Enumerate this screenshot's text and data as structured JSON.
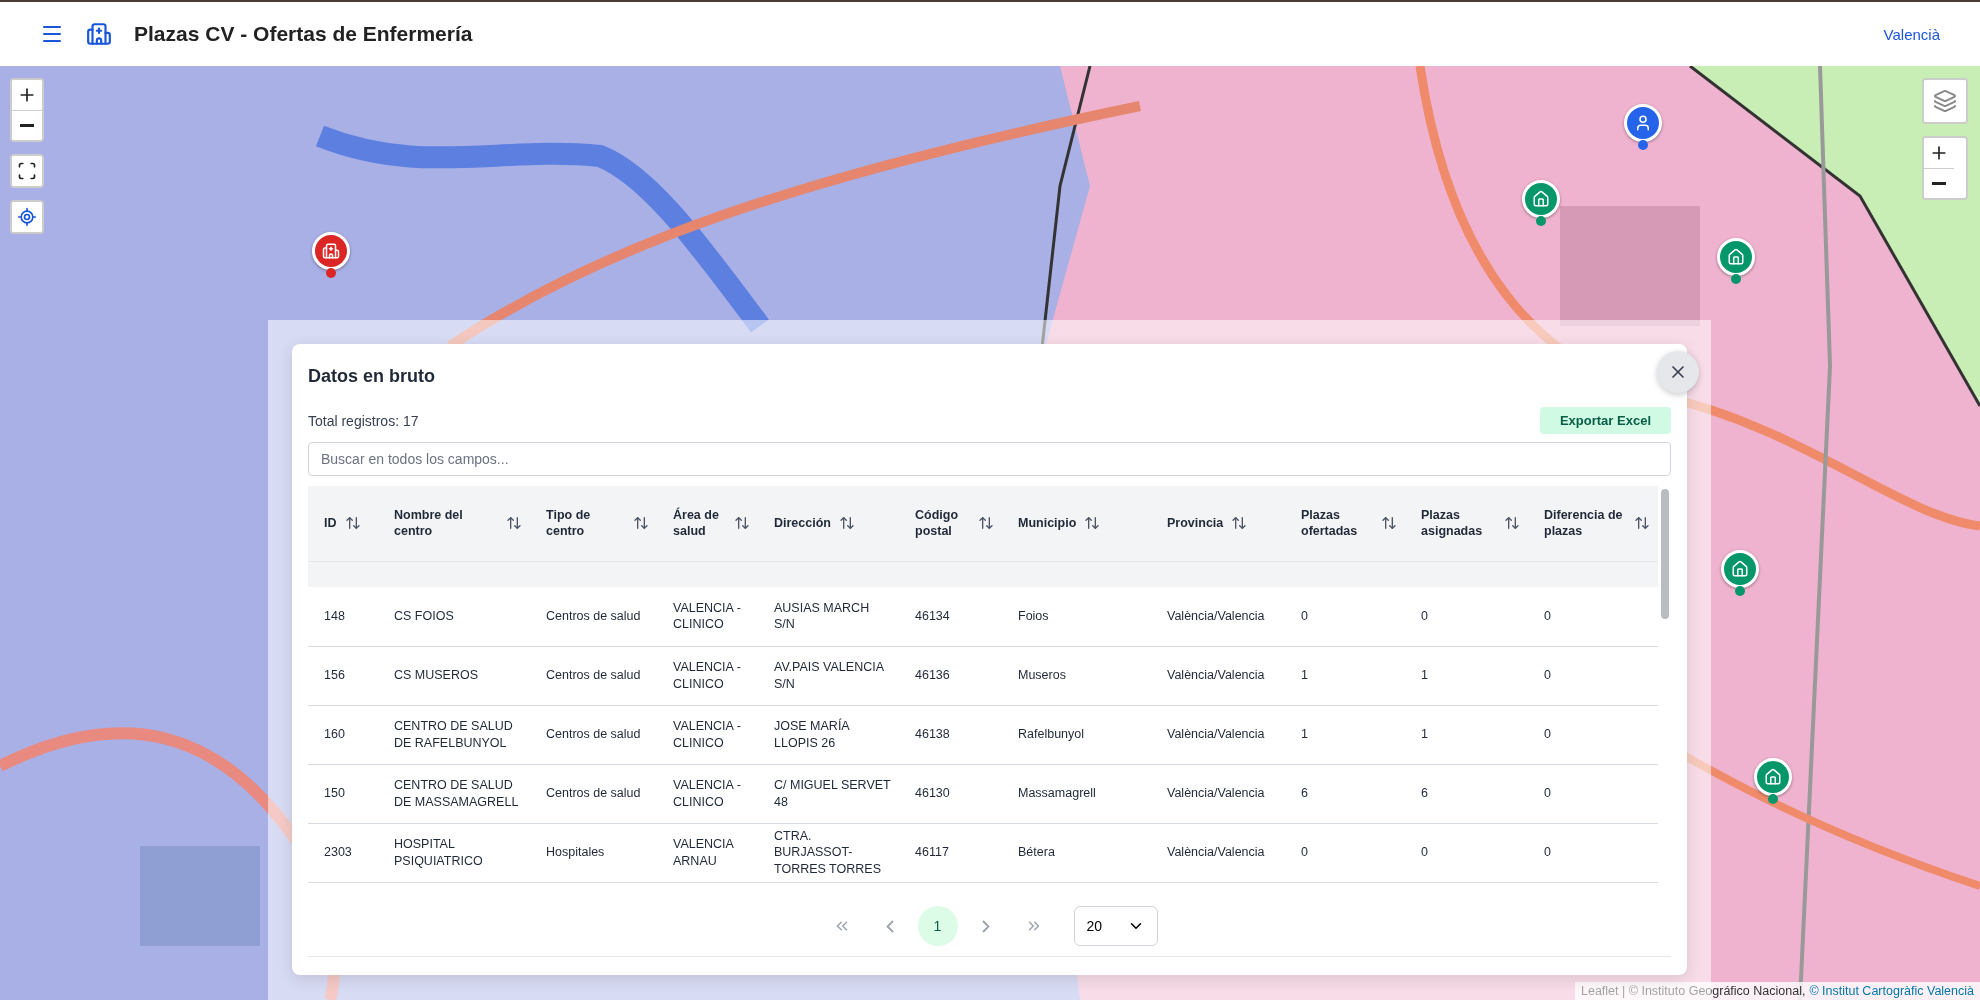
{
  "header": {
    "title": "Plazas CV - Ofertas de Enfermería",
    "language": "Valencià"
  },
  "map": {
    "markers": [
      {
        "kind": "hospital"
      },
      {
        "kind": "person"
      },
      {
        "kind": "health_center"
      },
      {
        "kind": "health_center"
      },
      {
        "kind": "health_center"
      },
      {
        "kind": "health_center"
      }
    ],
    "attribution": {
      "text": "Leaflet | © Instituto Geográfico Nacional,",
      "link": "© Institut Cartogràfic Valencià"
    }
  },
  "modal": {
    "title": "Datos en bruto",
    "total": "Total registros: 17",
    "export_button": "Exportar Excel",
    "search": {
      "placeholder": "Buscar en todos los campos..."
    },
    "columns": [
      "ID",
      "Nombre del centro",
      "Tipo de centro",
      "Área de salud",
      "Dirección",
      "Código postal",
      "Municipio",
      "Provincia",
      "Plazas ofertadas",
      "Plazas asignadas",
      "Diferencia de plazas"
    ],
    "rows": [
      [
        "148",
        "CS FOIOS",
        "Centros de salud",
        "VALENCIA - CLINICO",
        "AUSIAS MARCH S/N",
        "46134",
        "Foios",
        "València/Valencia",
        "0",
        "0",
        "0"
      ],
      [
        "156",
        "CS MUSEROS",
        "Centros de salud",
        "VALENCIA - CLINICO",
        "AV.PAIS VALENCIA S/N",
        "46136",
        "Museros",
        "València/Valencia",
        "1",
        "1",
        "0"
      ],
      [
        "160",
        "CENTRO DE SALUD DE RAFELBUNYOL",
        "Centros de salud",
        "VALENCIA - CLINICO",
        "JOSE MARÍA LLOPIS 26",
        "46138",
        "Rafelbunyol",
        "València/Valencia",
        "1",
        "1",
        "0"
      ],
      [
        "150",
        "CENTRO DE SALUD DE MASSAMAGRELL",
        "Centros de salud",
        "VALENCIA - CLINICO",
        "C/ MIGUEL SERVET 48",
        "46130",
        "Massamagrell",
        "València/Valencia",
        "6",
        "6",
        "0"
      ],
      [
        "2303",
        "HOSPITAL PSIQUIATRICO",
        "Hospitales",
        "VALENCIA ARNAU",
        "CTRA. BURJASSOT-TORRES TORRES",
        "46117",
        "Bétera",
        "València/Valencia",
        "0",
        "0",
        "0"
      ]
    ],
    "pagination": {
      "pages": [
        {
          "label": "1",
          "selected": true
        }
      ],
      "page_size": "20"
    }
  }
}
